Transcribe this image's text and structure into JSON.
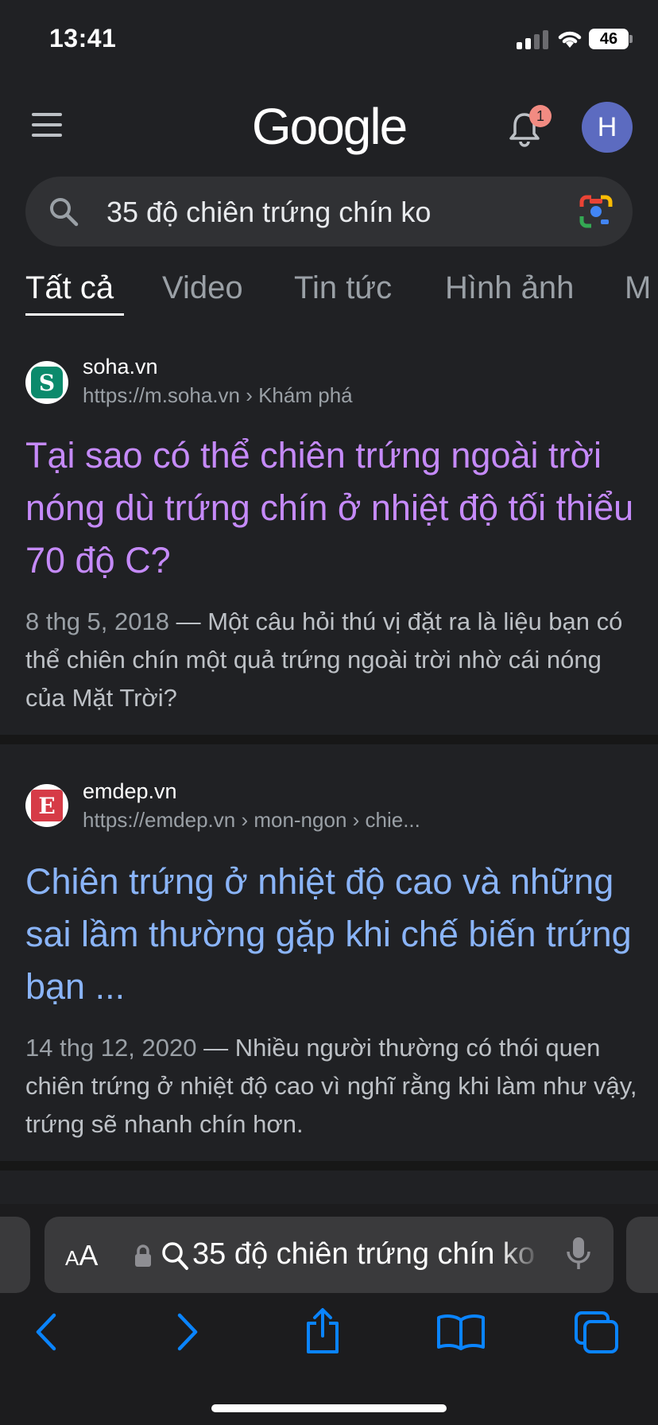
{
  "status_bar": {
    "time": "13:41",
    "battery": "46"
  },
  "header": {
    "logo": "Google",
    "notification_count": "1",
    "avatar_initial": "H"
  },
  "search": {
    "query": "35 độ chiên trứng chín ko"
  },
  "tabs": [
    {
      "label": "Tất cả",
      "active": true
    },
    {
      "label": "Video"
    },
    {
      "label": "Tin tức"
    },
    {
      "label": "Hình ảnh"
    },
    {
      "label": "M"
    }
  ],
  "results": [
    {
      "site": "soha.vn",
      "url": "https://m.soha.vn › Khám phá",
      "favicon_letter": "S",
      "title": "Tại sao có thể chiên trứng ngoài trời nóng dù trứng chín ở nhiệt độ tối thiểu 70 độ C?",
      "date": "8 thg 5, 2018",
      "snippet": " — Một câu hỏi thú vị đặt ra là liệu bạn có thể chiên chín một quả trứng ngoài trời nhờ cái nóng của Mặt Trời?",
      "title_color": "#c58af9"
    },
    {
      "site": "emdep.vn",
      "url": "https://emdep.vn › mon-ngon › chie...",
      "favicon_letter": "E",
      "title": "Chiên trứng ở nhiệt độ cao và những sai lầm thường gặp khi chế biến trứng bạn ...",
      "date": "14 thg 12, 2020",
      "snippet": " — Nhiều người thường có thói quen chiên trứng ở nhiệt độ cao vì nghĩ rằng khi làm như vậy, trứng sẽ nhanh chín hơn.",
      "title_color": "#8ab4f8"
    }
  ],
  "address_bar": {
    "aa_small": "A",
    "aa_big": "A",
    "text": "35 độ chiên trứng chín ko"
  },
  "colors": {
    "background": "#202124",
    "visited_link": "#c58af9",
    "link": "#8ab4f8",
    "safari_blue": "#0a84ff"
  }
}
